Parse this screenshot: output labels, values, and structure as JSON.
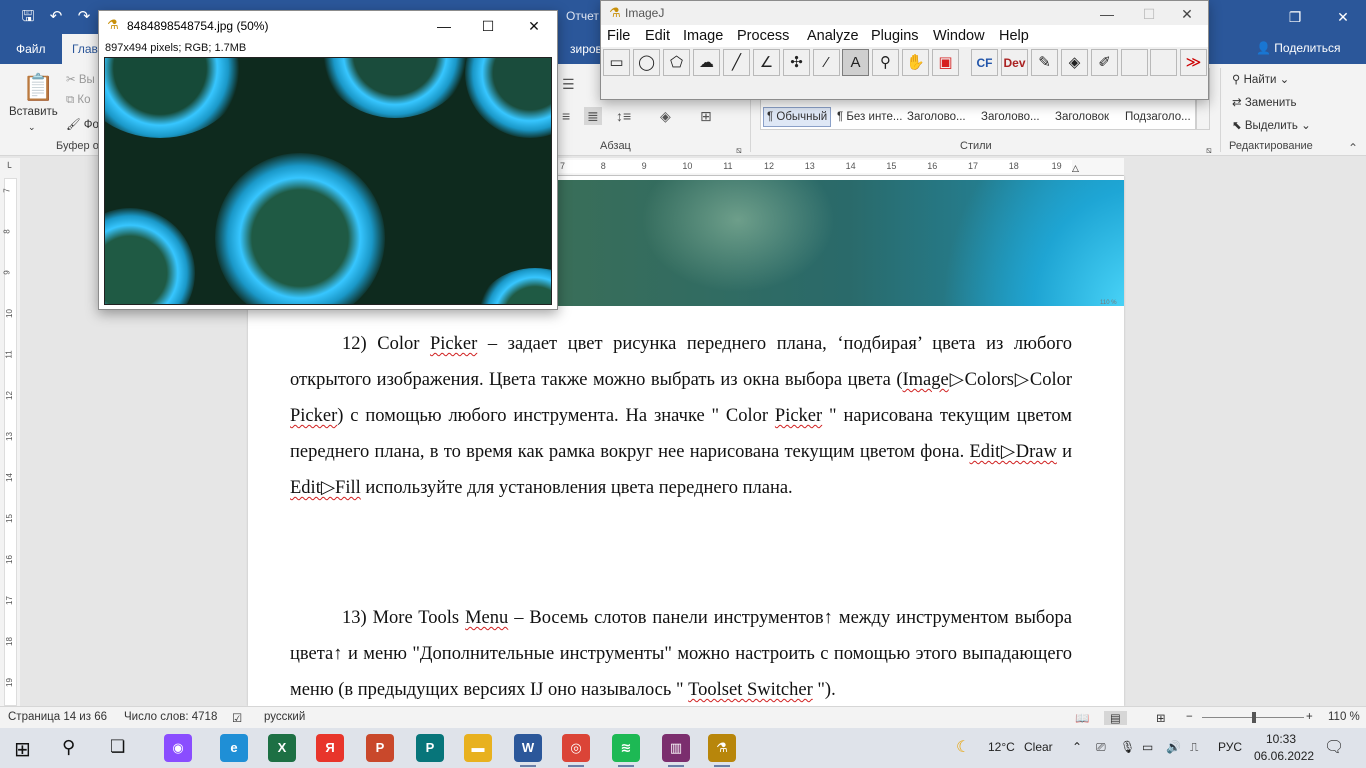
{
  "word": {
    "doc_title": "Отчет",
    "tabs": [
      {
        "label": "Файл"
      },
      {
        "label": "Главная"
      }
    ],
    "share_label": "Поделиться",
    "ribbon": {
      "paste_label": "Вставить",
      "cut_label": "Вы",
      "copy_label": "Ко",
      "format_label": "Фо",
      "clipboard_group": "Буфер о",
      "paragraph_group": "Абзац",
      "styles_group": "Стили",
      "editing_group": "Редактирование",
      "partial_tab_text": "зировани",
      "styles": [
        "¶ Обычный",
        "¶ Без инте...",
        "Заголово...",
        "Заголово...",
        "Заголовок",
        "Подзаголо..."
      ],
      "find_label": "Найти",
      "replace_label": "Заменить",
      "select_label": "Выделить"
    },
    "ruler_numbers": [
      "7",
      "8",
      "9",
      "10",
      "11",
      "12",
      "13",
      "14",
      "15",
      "16",
      "17",
      "18",
      "19"
    ],
    "vruler_numbers": [
      "7",
      "8",
      "9",
      "10",
      "11",
      "12",
      "13",
      "14",
      "15",
      "16",
      "17",
      "18",
      "19"
    ],
    "image_zoom_tag": "110 %",
    "paragraph12": {
      "p1": "12) Color ",
      "w_picker": "Picker",
      "p2": " – задает цвет рисунка переднего плана, ‘подбирая’ цвета из любого открытого изображения. Цвета также можно выбрать из окна выбора цвета (",
      "w_image": "Image",
      "p3": "▷Colors▷Color ",
      "w_picker2": "Picker",
      "p4": ") с помощью любого инструмента. На значке \" Color ",
      "w_picker3": "Picker",
      "p5": " \" нарисована текущим цветом переднего плана, в то время как рамка вокруг нее нарисована текущим цветом фона. ",
      "w_edit_draw": "Edit▷Draw",
      "p6": " и ",
      "w_edit_fill": "Edit▷Fill",
      "p7": " используйте для установления цвета переднего плана."
    },
    "paragraph13": {
      "p1": "13) More Tools ",
      "w_menu": "Menu",
      "p2": " – Восемь слотов панели инструментов↑ между инструментом выбора цвета↑ и меню \"Дополнительные инструменты\" можно настроить с помощью этого выпадающего меню (в предыдущих версиях IJ оно называлось \" ",
      "w_toolset": "Toolset Switcher",
      "p3": " \")."
    },
    "status": {
      "page": "Страница 14 из 66",
      "words": "Число слов: 4718",
      "lang": "русский",
      "zoom": "110 %",
      "zoom_fraction": 0.49
    }
  },
  "imagej_image": {
    "title": "8484898548754.jpg (50%)",
    "info": "897x494 pixels; RGB; 1.7MB"
  },
  "imagej_main": {
    "title": "ImageJ",
    "menu": [
      "File",
      "Edit",
      "Image",
      "Process",
      "Analyze",
      "Plugins",
      "Window",
      "Help"
    ],
    "tools": [
      {
        "name": "rectangle-tool-icon",
        "glyph": "▭"
      },
      {
        "name": "oval-tool-icon",
        "glyph": "◯"
      },
      {
        "name": "polygon-tool-icon",
        "glyph": "⬠"
      },
      {
        "name": "freehand-tool-icon",
        "glyph": "☁"
      },
      {
        "name": "line-tool-icon",
        "glyph": "╱"
      },
      {
        "name": "angle-tool-icon",
        "glyph": "∠"
      },
      {
        "name": "point-tool-icon",
        "glyph": "✣"
      },
      {
        "name": "wand-tool-icon",
        "glyph": "⁄"
      },
      {
        "name": "text-tool-icon",
        "glyph": "A"
      },
      {
        "name": "magnifier-tool-icon",
        "glyph": "⚲"
      },
      {
        "name": "hand-tool-icon",
        "glyph": "✋"
      },
      {
        "name": "color-picker-tool-icon",
        "glyph": "▣"
      },
      {
        "name": "cf-tool-icon",
        "glyph": "CF"
      },
      {
        "name": "dev-tool-icon",
        "glyph": "Dev"
      },
      {
        "name": "brush-tool-icon",
        "glyph": "✎"
      },
      {
        "name": "flood-fill-tool-icon",
        "glyph": "◈"
      },
      {
        "name": "pencil-tool-icon",
        "glyph": "✐"
      },
      {
        "name": "empty-slot-1-icon",
        "glyph": ""
      },
      {
        "name": "empty-slot-2-icon",
        "glyph": ""
      },
      {
        "name": "more-tools-icon",
        "glyph": "≫"
      }
    ]
  },
  "taskbar": {
    "weather": "12°C",
    "weather_text": "Clear",
    "lang": "РУС",
    "time": "10:33",
    "date": "06.06.2022",
    "apps": [
      {
        "name": "taskbar-alice-icon",
        "glyph": "◉",
        "color": "#8a4dff"
      },
      {
        "name": "taskbar-edge-icon",
        "glyph": "e",
        "color": "#1f8fd6"
      },
      {
        "name": "taskbar-excel-icon",
        "glyph": "X",
        "color": "#1d7044"
      },
      {
        "name": "taskbar-yandex-icon",
        "glyph": "Я",
        "color": "#e8352b"
      },
      {
        "name": "taskbar-powerpoint-icon",
        "glyph": "P",
        "color": "#c9482b"
      },
      {
        "name": "taskbar-publisher-icon",
        "glyph": "P",
        "color": "#07757a"
      },
      {
        "name": "taskbar-explorer-icon",
        "glyph": "▬",
        "color": "#e8b11f"
      },
      {
        "name": "taskbar-word-icon",
        "glyph": "W",
        "color": "#2b579a"
      },
      {
        "name": "taskbar-chrome-icon",
        "glyph": "◎",
        "color": "#db4437"
      },
      {
        "name": "taskbar-spotify-icon",
        "glyph": "≋",
        "color": "#1db954"
      },
      {
        "name": "taskbar-winrar-icon",
        "glyph": "▥",
        "color": "#7b2e6e"
      },
      {
        "name": "taskbar-imagej-icon",
        "glyph": "⚗",
        "color": "#b8860b"
      }
    ]
  },
  "colors": {
    "word_blue": "#2b579a",
    "spell_red": "#d02020",
    "cell_cyan": "#37c6ff"
  }
}
